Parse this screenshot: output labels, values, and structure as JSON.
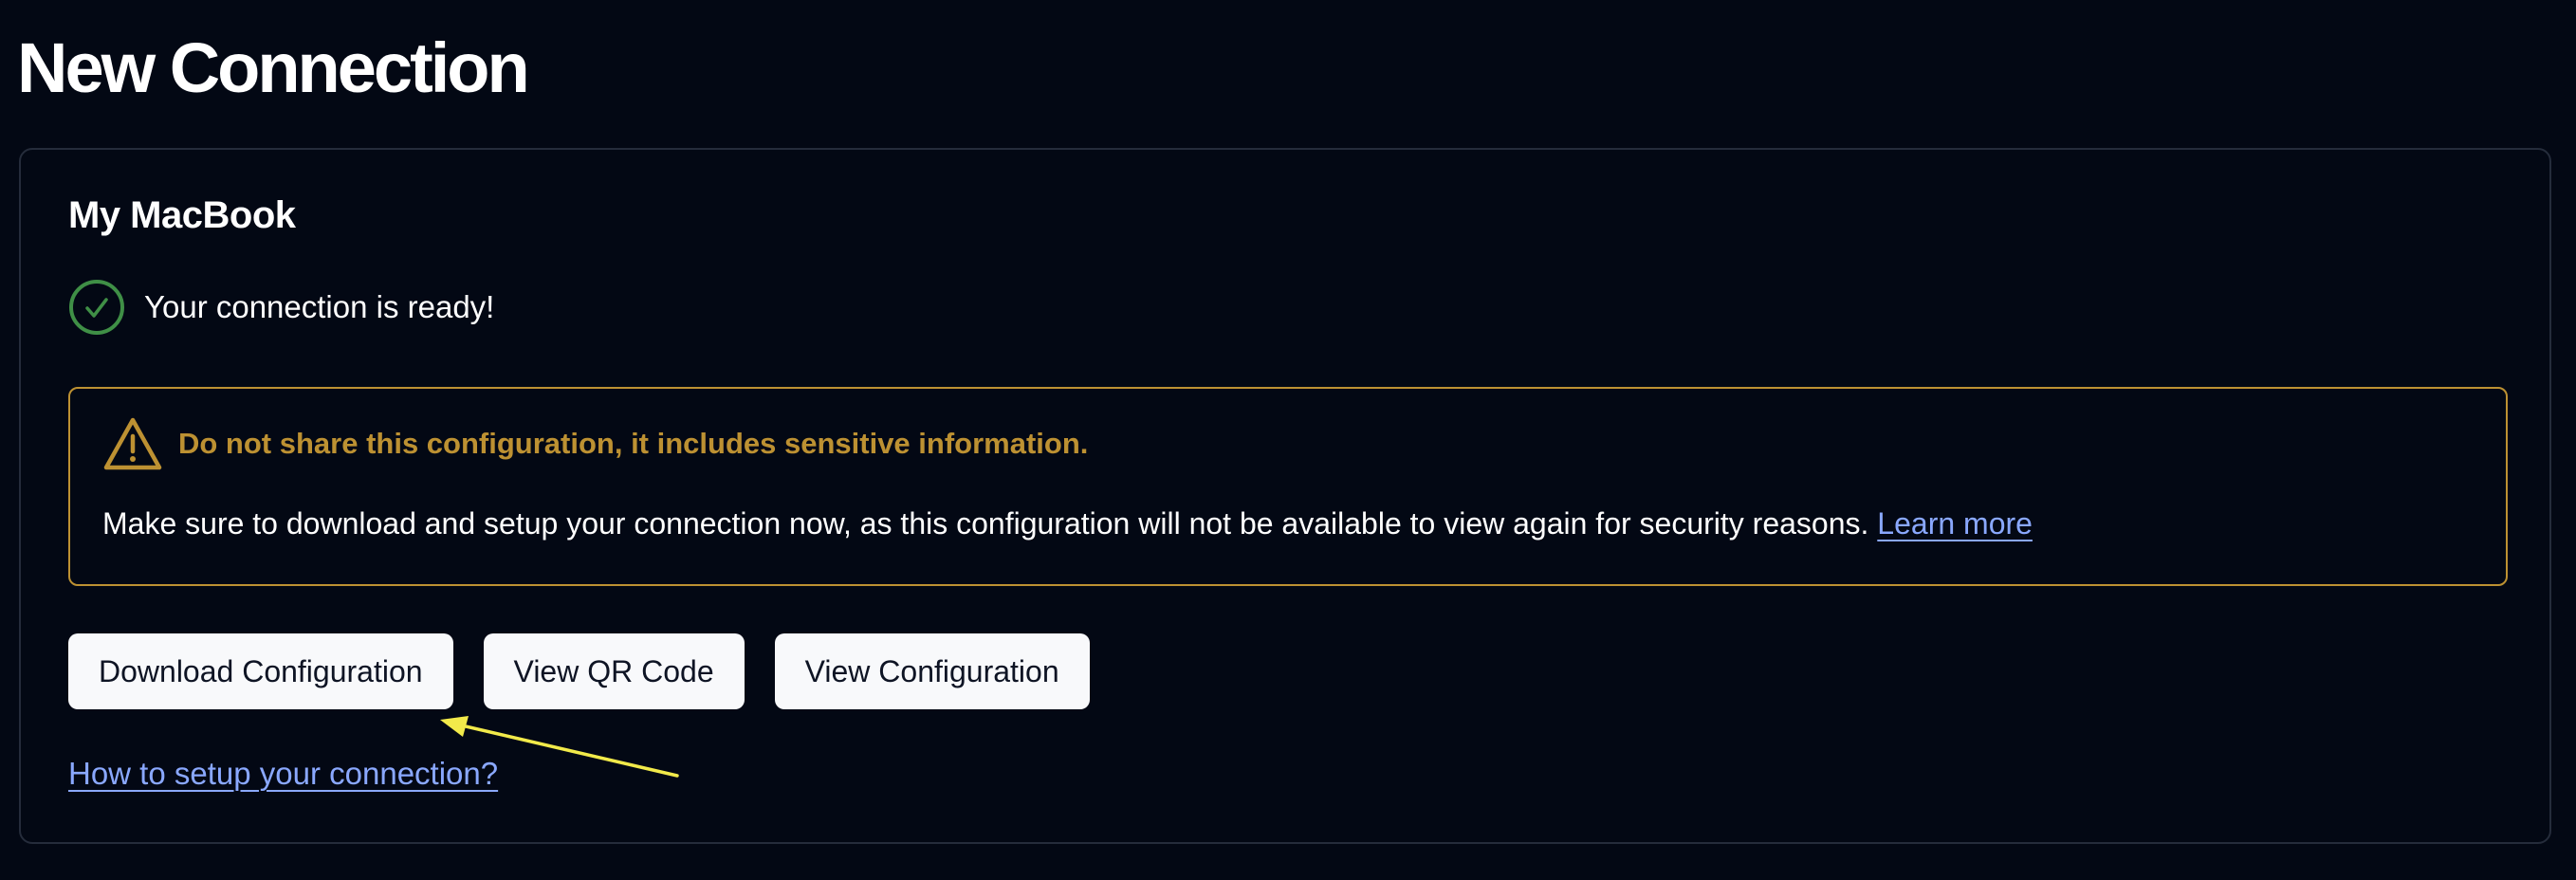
{
  "page": {
    "title": "New Connection"
  },
  "connection": {
    "device_name": "My MacBook",
    "status_text": "Your connection is ready!",
    "status_icon": "check-circle-icon"
  },
  "warning": {
    "icon": "warning-triangle-icon",
    "title": "Do not share this configuration, it includes sensitive information.",
    "body": "Make sure to download and setup your connection now, as this configuration will not be available to view again for security reasons.",
    "link_label": "Learn more"
  },
  "actions": {
    "download_label": "Download Configuration",
    "qr_label": "View QR Code",
    "view_config_label": "View Configuration"
  },
  "help": {
    "link_label": "How to setup your connection?"
  },
  "colors": {
    "background": "#030814",
    "card_border": "#252c3b",
    "success": "#3f8f46",
    "warning": "#bd9132",
    "link": "#8aa8ff",
    "button_bg": "#f8f9fb",
    "annotation_arrow": "#f2ea4a"
  }
}
